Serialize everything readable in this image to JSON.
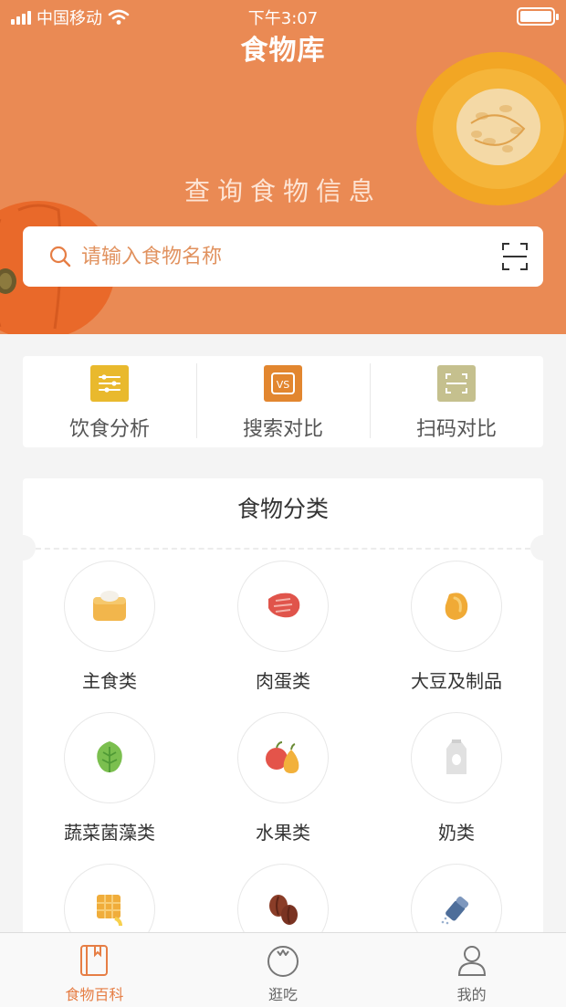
{
  "status": {
    "carrier": "中国移动",
    "time": "下午3:07"
  },
  "header": {
    "title": "食物库",
    "subtitle": "查询食物信息"
  },
  "search": {
    "placeholder": "请输入食物名称"
  },
  "quick_actions": [
    {
      "label": "饮食分析",
      "icon": "diet-analysis-icon",
      "color": "#e9b92d"
    },
    {
      "label": "搜索对比",
      "icon": "vs-compare-icon",
      "color": "#e2862f"
    },
    {
      "label": "扫码对比",
      "icon": "scan-compare-icon",
      "color": "#c5c08e"
    }
  ],
  "categories": {
    "title": "食物分类",
    "items": [
      {
        "label": "主食类",
        "icon": "bread-icon"
      },
      {
        "label": "肉蛋类",
        "icon": "meat-icon"
      },
      {
        "label": "大豆及制品",
        "icon": "soybean-icon"
      },
      {
        "label": "蔬菜菌藻类",
        "icon": "vegetable-leaf-icon"
      },
      {
        "label": "水果类",
        "icon": "fruit-icon"
      },
      {
        "label": "奶类",
        "icon": "milk-carton-icon"
      },
      {
        "label": "",
        "icon": "waffle-icon"
      },
      {
        "label": "",
        "icon": "coffee-beans-icon"
      },
      {
        "label": "",
        "icon": "salt-shaker-icon"
      }
    ]
  },
  "tabbar": {
    "items": [
      {
        "label": "食物百科",
        "active": true
      },
      {
        "label": "逛吃",
        "active": false
      },
      {
        "label": "我的",
        "active": false
      }
    ],
    "active_color": "#e67e45"
  },
  "colors": {
    "header_bg": "#ea8a54",
    "accent": "#e67e45"
  }
}
